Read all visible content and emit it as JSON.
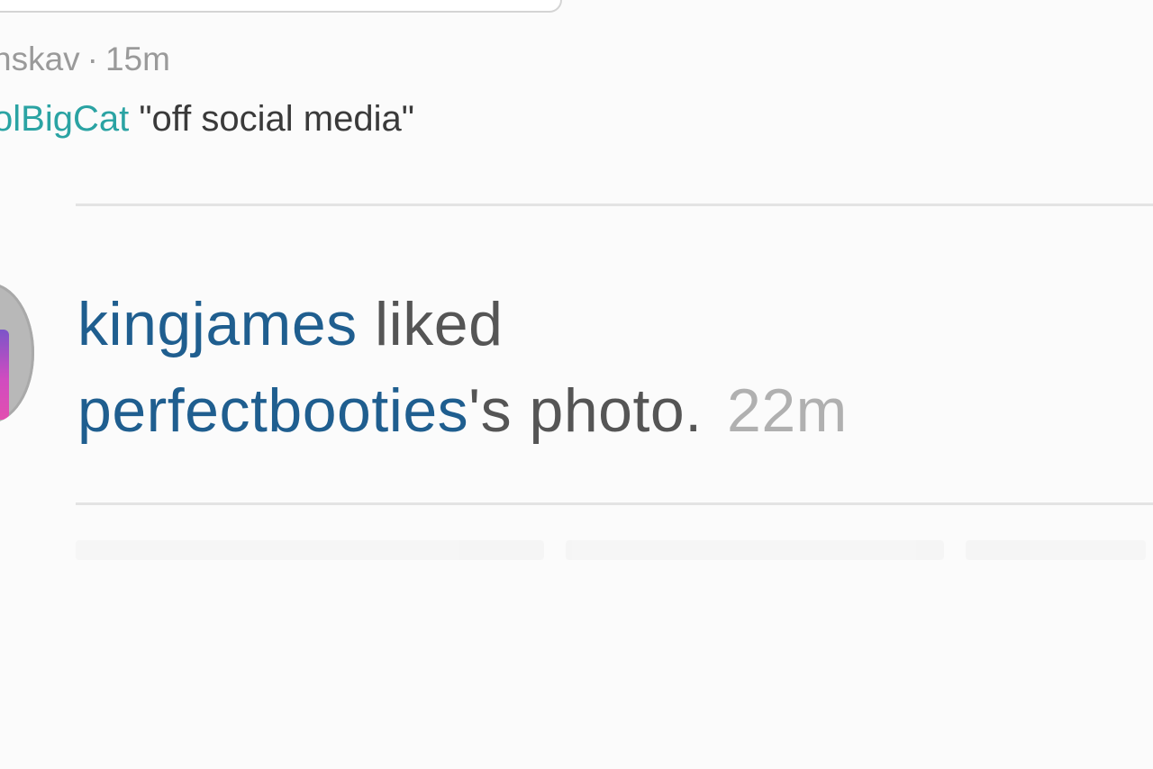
{
  "tweet": {
    "username": "nskav",
    "separator": "·",
    "timestamp": "15m",
    "mention": "olBigCat",
    "text": "\"off social media\""
  },
  "activity": {
    "actor": "kingjames",
    "verb": "liked",
    "target": "perfectbooties",
    "object_suffix": "'s photo.",
    "timestamp": "22m"
  },
  "colors": {
    "link_blue": "#1f5e8f",
    "mention_teal": "#2aa3a3",
    "text_gray": "#555555",
    "time_gray": "#b0b0b0"
  }
}
